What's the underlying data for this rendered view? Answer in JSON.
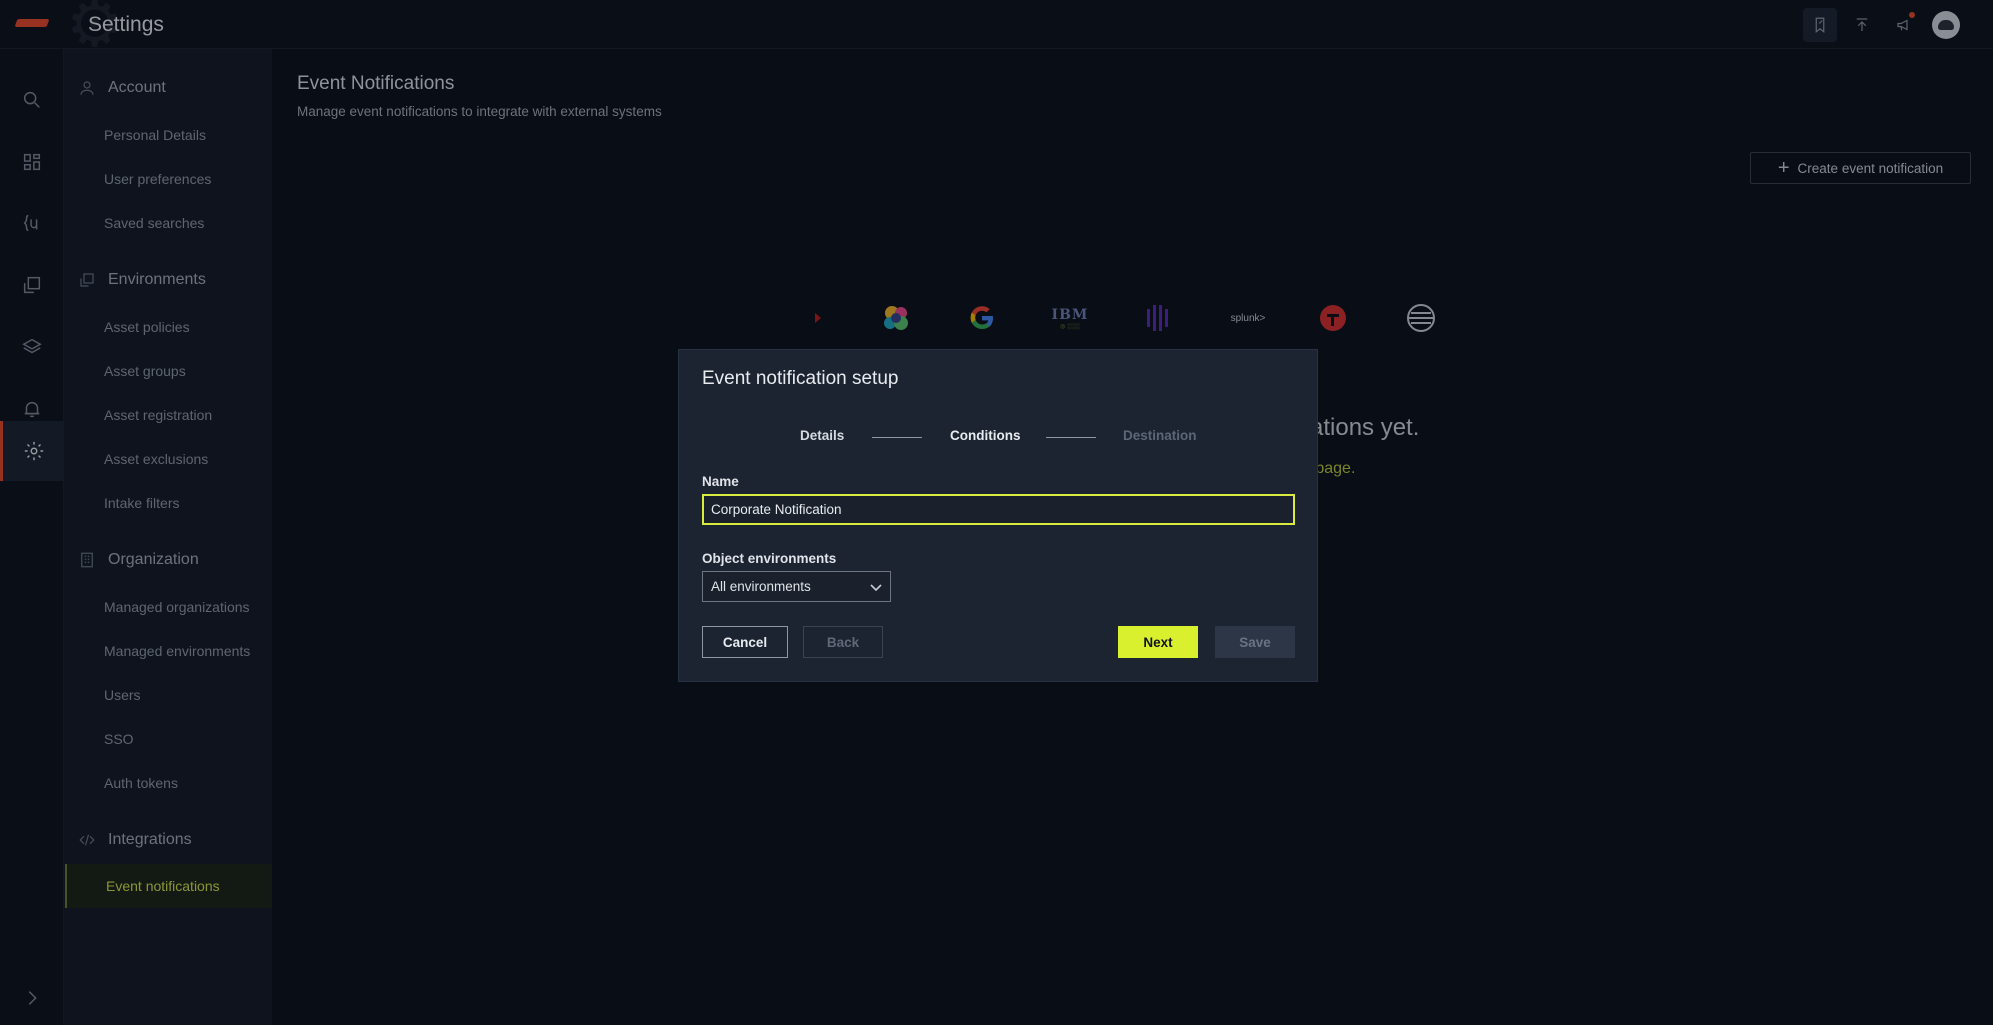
{
  "app": {
    "title": "Settings"
  },
  "topbar": {
    "icons": [
      "bookmark-icon",
      "upload-icon",
      "megaphone-icon",
      "avatar-incognito-icon"
    ]
  },
  "rail": {
    "icons": [
      "search-icon",
      "dashboard-icon",
      "query-icon",
      "reports-icon",
      "layers-icon",
      "bell-icon",
      "settings-icon",
      "expand-chevron-icon"
    ],
    "active": "settings-icon"
  },
  "sidebar": {
    "account": {
      "title": "Account",
      "items": [
        "Personal Details",
        "User preferences",
        "Saved searches"
      ]
    },
    "environments": {
      "title": "Environments",
      "items": [
        "Asset policies",
        "Asset groups",
        "Asset registration",
        "Asset exclusions",
        "Intake filters"
      ]
    },
    "organization": {
      "title": "Organization",
      "items": [
        "Managed organizations",
        "Managed environments",
        "Users",
        "SSO",
        "Auth tokens"
      ]
    },
    "integrations": {
      "title": "Integrations",
      "items": [
        "Event notifications"
      ]
    }
  },
  "main": {
    "title": "Event Notifications",
    "subtitle": "Manage event notifications to integrate with external systems",
    "create_label": "Create event notification",
    "empty_title": "fications yet.",
    "empty_link": "n page.",
    "logos": {
      "splunk": "splunk>",
      "ibm": "IBM"
    }
  },
  "modal": {
    "title": "Event notification setup",
    "steps": [
      "Details",
      "Conditions",
      "Destination"
    ],
    "name_label": "Name",
    "name_value": "Corporate Notification",
    "env_label": "Object environments",
    "env_value": "All environments",
    "buttons": {
      "cancel": "Cancel",
      "back": "Back",
      "next": "Next",
      "save": "Save"
    }
  },
  "colors": {
    "accent": "#d9f02e",
    "brand": "#e5472a",
    "background": "#0b101a",
    "modal": "#1c2431"
  }
}
